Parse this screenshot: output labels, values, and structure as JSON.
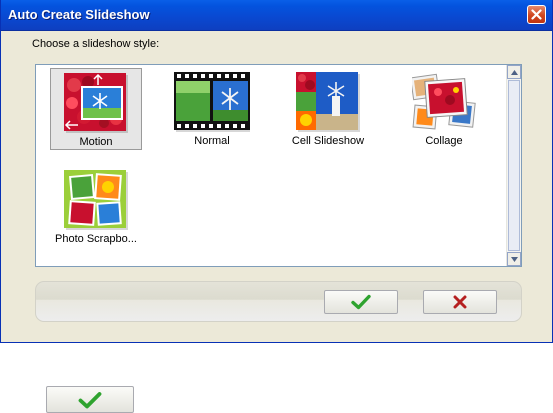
{
  "window": {
    "title": "Auto Create Slideshow",
    "close_icon": "close-icon"
  },
  "prompt": "Choose a slideshow style:",
  "styles": [
    {
      "label": "Motion",
      "icon": "motion-thumbnail",
      "selected": true
    },
    {
      "label": "Normal",
      "icon": "normal-thumbnail",
      "selected": false
    },
    {
      "label": "Cell Slideshow",
      "icon": "cell-slideshow-thumbnail",
      "selected": false
    },
    {
      "label": "Collage",
      "icon": "collage-thumbnail",
      "selected": false
    },
    {
      "label": "Photo Scrapbo...",
      "icon": "photo-scrapbook-thumbnail",
      "selected": false
    }
  ],
  "buttons": {
    "ok_icon": "checkmark-icon",
    "cancel_icon": "x-icon"
  },
  "colors": {
    "titlebar": "#0a48d0",
    "ok_green": "#2fa32f",
    "cancel_red": "#b52020"
  }
}
